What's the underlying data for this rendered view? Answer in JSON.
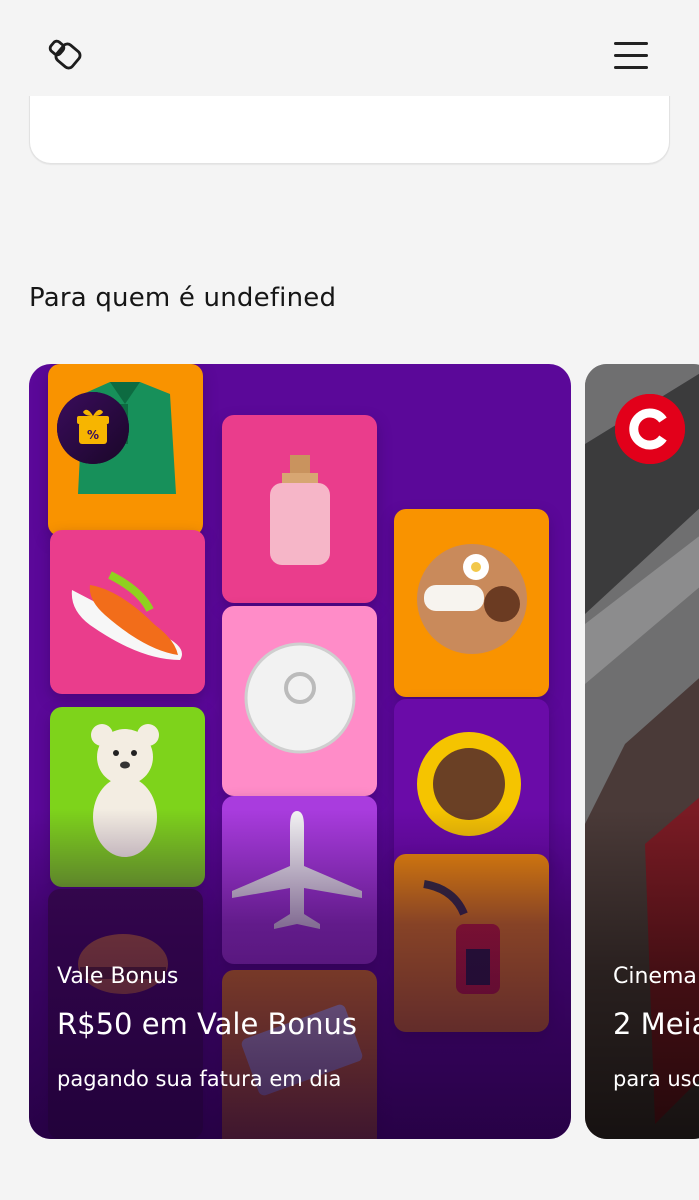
{
  "header": {
    "logo_icon": "brand-logo-icon",
    "menu_icon": "hamburger-menu-icon"
  },
  "section": {
    "title": "Para quem é undefined"
  },
  "cards": [
    {
      "badge_icon": "gift-discount-icon",
      "brand": "Vale Bonus",
      "title": "R$50 em Vale Bonus",
      "subtitle": "pagando sua fatura em dia",
      "colors": {
        "background": "#5b0899",
        "orange": "#f99300",
        "pink": "#ea3d8c",
        "green": "#7ed31b"
      }
    },
    {
      "logo_icon": "cinema-c-logo-icon",
      "brand": "Cinema",
      "title": "2 Meia",
      "subtitle": "para uso",
      "colors": {
        "logo": "#e2001a"
      }
    }
  ]
}
